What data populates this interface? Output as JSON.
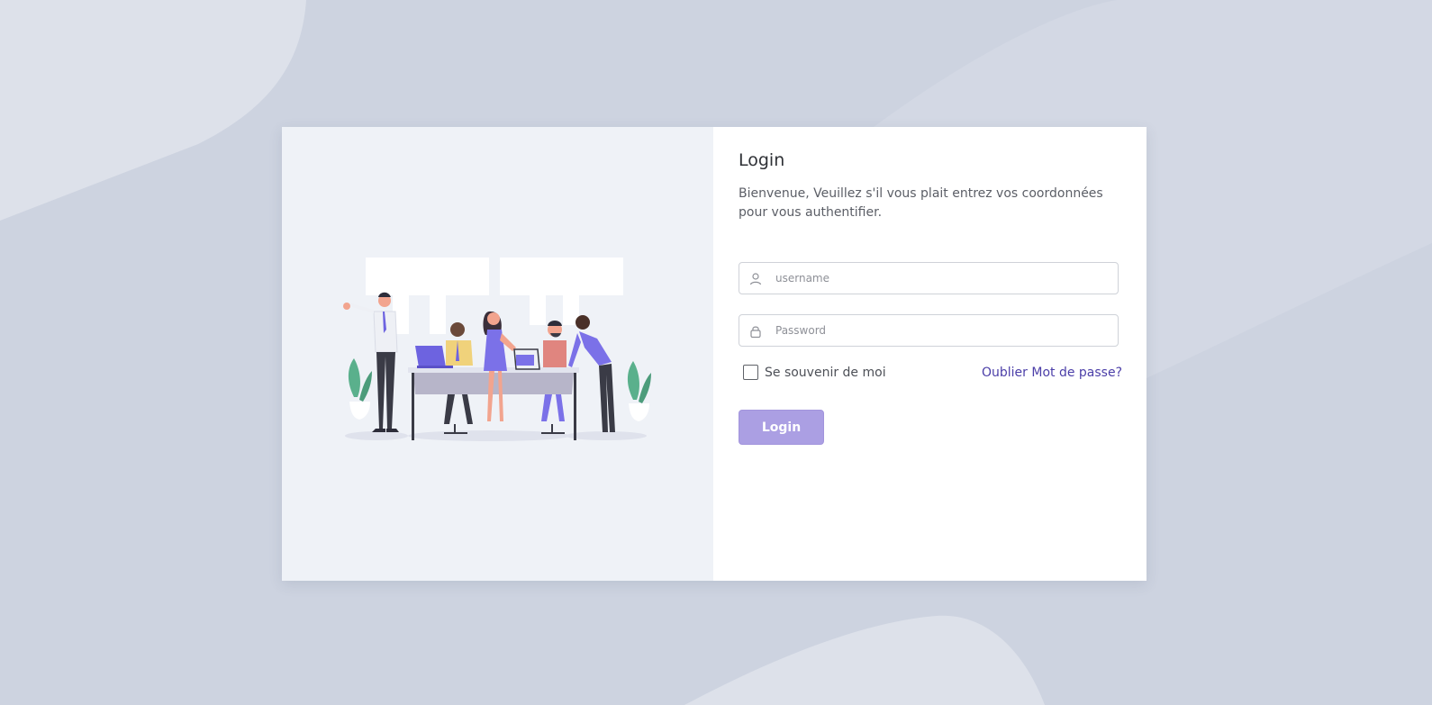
{
  "login": {
    "title": "Login",
    "welcome": "Bienvenue, Veuillez s'il vous plait entrez vos coordonnées pour vous authentifier.",
    "username_placeholder": "username",
    "username_value": "",
    "password_placeholder": "Password",
    "password_value": "",
    "remember_label": "Se souvenir de moi",
    "remember_checked": false,
    "forgot_label": "Oublier Mot de passe?",
    "submit_label": "Login"
  },
  "icons": {
    "username_icon": "user-icon",
    "password_icon": "lock-icon"
  },
  "colors": {
    "background": "#cdd3e0",
    "illustration_panel": "#eff2f7",
    "accent_link": "#4b3ea8",
    "button": "#ab9fe3"
  }
}
